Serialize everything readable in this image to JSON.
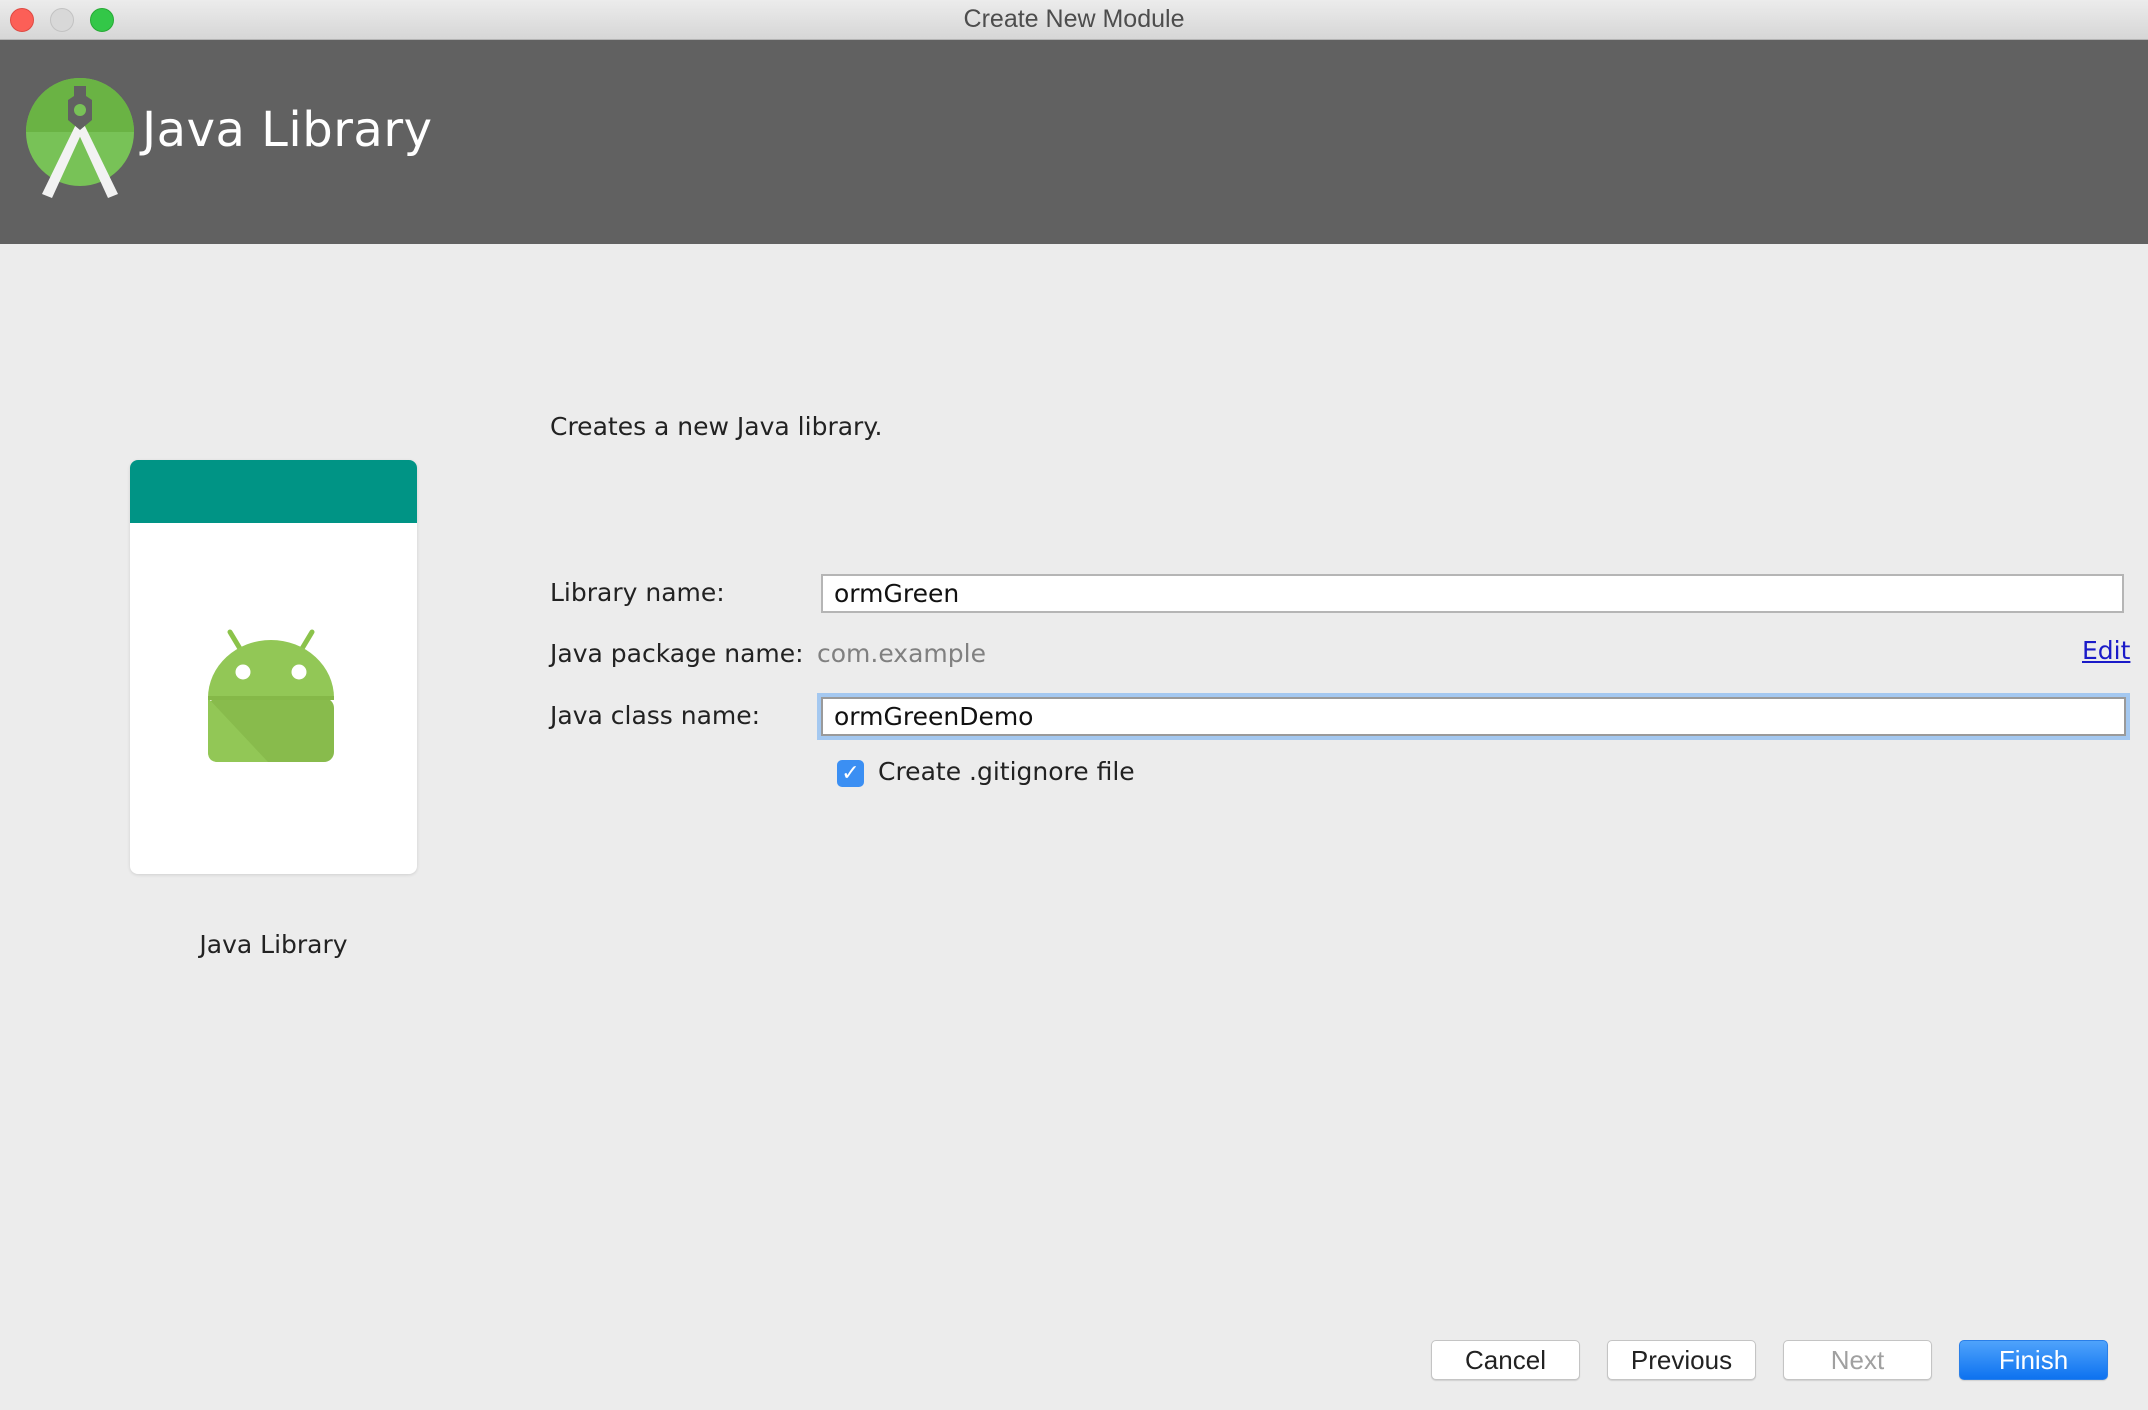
{
  "window": {
    "title": "Create New Module",
    "controls": [
      "close",
      "minimize",
      "maximize"
    ]
  },
  "header": {
    "title": "Java Library",
    "logo_icon": "android-studio-logo-icon"
  },
  "template_card": {
    "label": "Java Library",
    "icon": "android-robot-icon",
    "bar_color": "#009485"
  },
  "form": {
    "description": "Creates a new Java library.",
    "library_name": {
      "label": "Library name:",
      "value": "ormGreen"
    },
    "package_name": {
      "label": "Java package name:",
      "value": "com.example",
      "edit_label": "Edit"
    },
    "class_name": {
      "label": "Java class name:",
      "value": "ormGreenDemo"
    },
    "gitignore": {
      "label": "Create .gitignore file",
      "checked": true
    }
  },
  "buttons": {
    "cancel": "Cancel",
    "previous": "Previous",
    "next": "Next",
    "finish": "Finish"
  },
  "colors": {
    "header_bg": "#616161",
    "accent_blue": "#0d72f0",
    "link": "#1a1ac8"
  }
}
